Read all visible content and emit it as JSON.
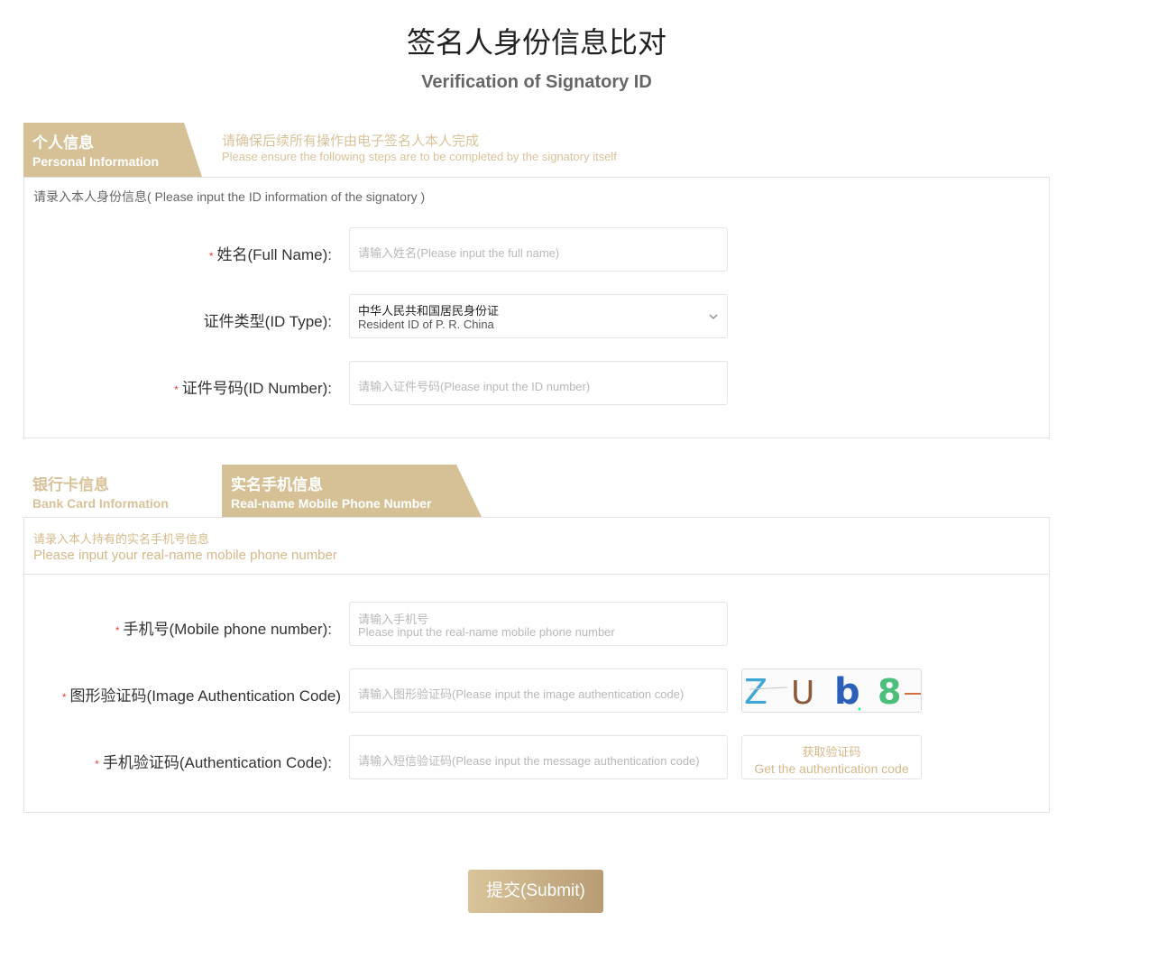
{
  "page": {
    "title": "签名人身份信息比对",
    "subtitle": "Verification of Signatory ID"
  },
  "personal": {
    "tab_cn": "个人信息",
    "tab_en": "Personal Information",
    "hint_cn": "请确保后续所有操作由电子签名人本人完成",
    "hint_en": "Please ensure the following steps are to be completed by the signatory itself",
    "note": "请录入本人身份信息( Please input the ID information of the signatory )",
    "name_label": "姓名(Full Name):",
    "name_placeholder": "请输入姓名(Please input the full name)",
    "idtype_label": "证件类型(ID Type):",
    "idtype_value_cn": "中华人民共和国居民身份证",
    "idtype_value_en": "Resident ID of P. R. China",
    "idnum_label": "证件号码(ID Number):",
    "idnum_placeholder": "请输入证件号码(Please input the ID number)"
  },
  "tabs2": {
    "bank_cn": "银行卡信息",
    "bank_en": "Bank Card Information",
    "mobile_cn": "实名手机信息",
    "mobile_en": "Real-name Mobile Phone Number"
  },
  "mobile": {
    "note_cn": "请录入本人持有的实名手机号信息",
    "note_en": "Please input your real-name mobile phone number",
    "phone_label": "手机号(Mobile phone number):",
    "phone_placeholder_cn": "请输入手机号",
    "phone_placeholder_en": "Please input the real-name mobile phone number",
    "img_code_label": "图形验证码(Image Authentication Code)",
    "img_code_placeholder": "请输入图形验证码(Please input the image authentication code)",
    "captcha_text": "ZUb8",
    "sms_code_label": "手机验证码(Authentication Code):",
    "sms_code_placeholder": "请输入短信验证码(Please input the message authentication code)",
    "get_code_cn": "获取验证码",
    "get_code_en": "Get the authentication code"
  },
  "submit": {
    "label": "提交(Submit)"
  },
  "colors": {
    "accent": "#d6c196",
    "required": "#e0463b"
  }
}
